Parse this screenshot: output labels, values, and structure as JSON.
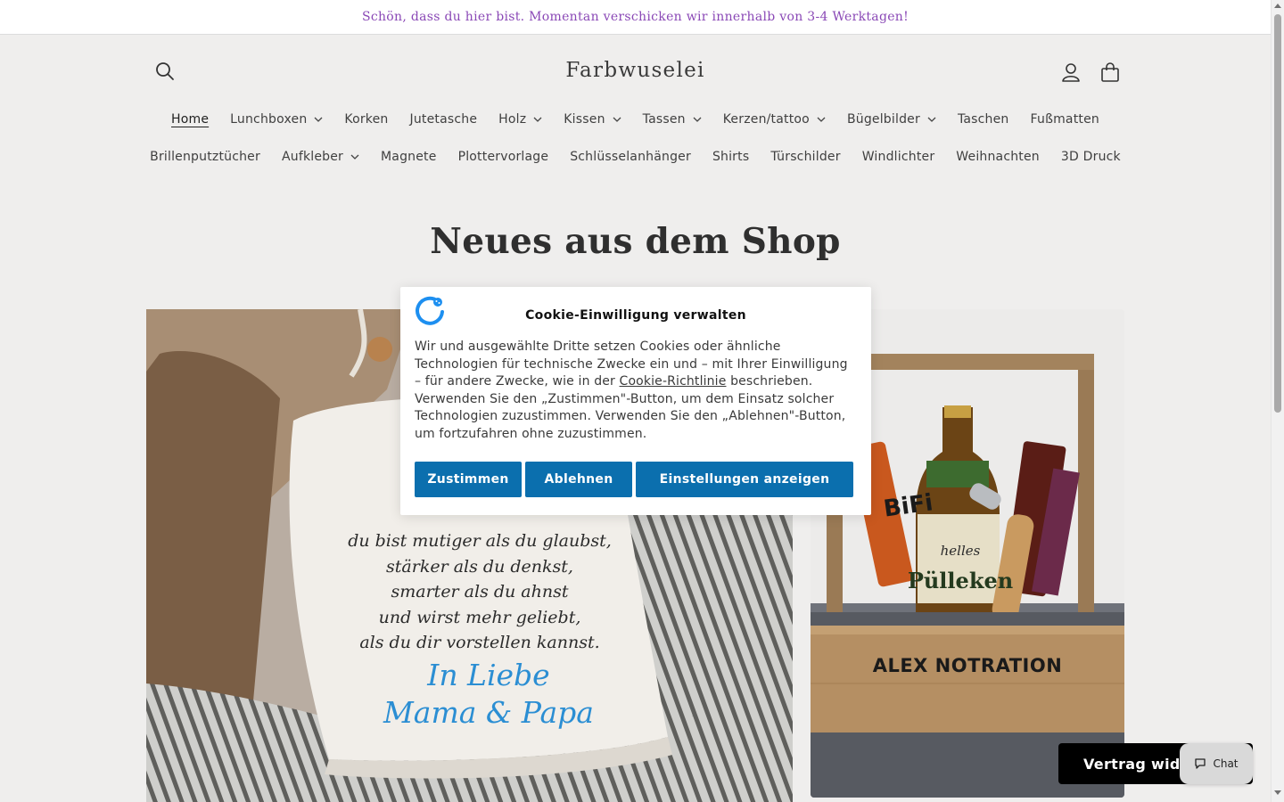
{
  "announcement": {
    "text": "Schön, dass du hier bist. Momentan verschicken wir innerhalb von 3-4 Werktagen!"
  },
  "header": {
    "logo": "Farbwuselei",
    "icons": {
      "search": "search-icon",
      "account": "account-icon",
      "cart": "cart-icon"
    }
  },
  "nav": {
    "row1": [
      {
        "label": "Home",
        "active": true,
        "dropdown": false
      },
      {
        "label": "Lunchboxen",
        "dropdown": true
      },
      {
        "label": "Korken",
        "dropdown": false
      },
      {
        "label": "Jutetasche",
        "dropdown": false
      },
      {
        "label": "Holz",
        "dropdown": true
      },
      {
        "label": "Kissen",
        "dropdown": true
      },
      {
        "label": "Tassen",
        "dropdown": true
      },
      {
        "label": "Kerzen/tattoo",
        "dropdown": true
      },
      {
        "label": "Bügelbilder",
        "dropdown": true
      },
      {
        "label": "Taschen",
        "dropdown": false
      },
      {
        "label": "Fußmatten",
        "dropdown": false
      }
    ],
    "row2": [
      {
        "label": "Brillenputztücher",
        "dropdown": false
      },
      {
        "label": "Aufkleber",
        "dropdown": true
      },
      {
        "label": "Magnete",
        "dropdown": false
      },
      {
        "label": "Plottervorlage",
        "dropdown": false
      },
      {
        "label": "Schlüsselanhänger",
        "dropdown": false
      },
      {
        "label": "Shirts",
        "dropdown": false
      },
      {
        "label": "Türschilder",
        "dropdown": false
      },
      {
        "label": "Windlichter",
        "dropdown": false
      },
      {
        "label": "Weihnachten",
        "dropdown": false
      },
      {
        "label": "3D Druck",
        "dropdown": false
      }
    ]
  },
  "main": {
    "section_title": "Neues aus dem Shop",
    "pillow_poem": [
      "du bist mutiger als du glaubst,",
      "stärker als du denkst,",
      "smarter als du ahnst",
      "und wirst mehr geliebt,",
      "als du dir vorstellen kannst."
    ],
    "pillow_signature": [
      "In Liebe",
      "Mama & Papa"
    ],
    "crate_label": "ALEX NOTRATION",
    "bottle_small": "helles",
    "bottle_big": "Pülleken",
    "snack_text": "BiFi"
  },
  "cookie": {
    "title": "Cookie-Einwilligung verwalten",
    "text_before_link": "Wir und ausgewählte Dritte setzen Cookies oder ähnliche Technologien für technische Zwecke ein und – mit Ihrer Einwilligung – für andere Zwecke, wie in der ",
    "link_label": "Cookie-Richtlinie",
    "text_after_link": " beschrieben. Verwenden Sie den „Zustimmen\"-Button, um dem Einsatz solcher Technologien zuzustimmen. Verwenden Sie den „Ablehnen\"-Button, um fortzufahren ohne zuzustimmen.",
    "accept_label": "Zustimmen",
    "deny_label": "Ablehnen",
    "settings_label": "Einstellungen anzeigen",
    "button_color": "#0b6fae"
  },
  "widgets": {
    "vertrag_label": "Vertrag widerrufen",
    "chat_label": "Chat"
  },
  "colors": {
    "page_bg": "#efeeed",
    "announcement_text": "#8a48b6",
    "signature_blue": "#2b8ed3"
  }
}
